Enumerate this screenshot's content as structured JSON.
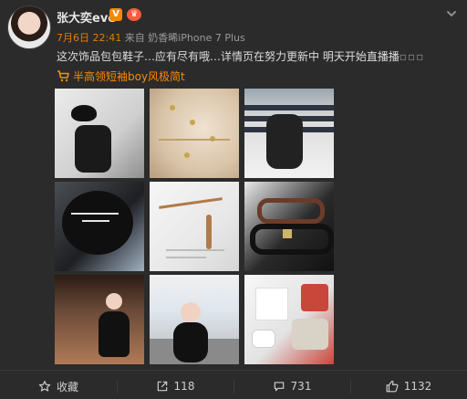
{
  "user": {
    "name": "张大奕eve",
    "badge_v": "V",
    "badge_icon": "crown-badge-icon"
  },
  "meta": {
    "date_time": "7月6日 22:41",
    "source_prefix": "来自",
    "source": "奶香晞iPhone 7 Plus"
  },
  "post": {
    "text": "这次饰品包包鞋子…应有尽有哦…详情页在努力更新中 明天开始直播播",
    "tail": "▫▫▫",
    "link_text": "半高领短袖boy风极简t",
    "link_icon": "shopping-cart-icon"
  },
  "actions": {
    "favorite_label": "收藏",
    "repost_count": "118",
    "comment_count": "731",
    "like_count": "1132"
  },
  "icons": {
    "dropdown": "chevron-down-icon",
    "favorite": "star-icon",
    "repost": "share-box-icon",
    "comment": "comment-bubble-icon",
    "like": "thumbs-up-icon"
  },
  "colors": {
    "background": "#2b2b2b",
    "text": "#dcdcdc",
    "muted": "#9a9a9a",
    "accent_orange": "#ff8a00",
    "time_orange": "#e87a00"
  }
}
